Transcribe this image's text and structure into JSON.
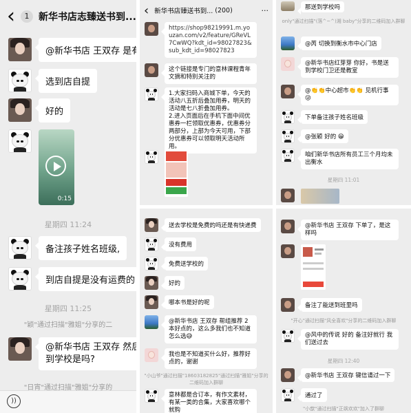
{
  "left": {
    "header": {
      "back": "‹",
      "badge": "1",
      "title": "新华书店志臻送书到..."
    },
    "messages": [
      {
        "text": "@新华书店 王双存 是有"
      },
      {
        "text": "选到店自提"
      },
      {
        "text": "好的"
      },
      {
        "text": "备注孩子姓名班级,"
      },
      {
        "text": "到店自提是没有运费的"
      },
      {
        "text": "@新华书店 王双存 然后"
      },
      {
        "text": "到学校是吗?"
      }
    ],
    "video_duration": "0:15",
    "times": [
      "星期四 11:24",
      "星期四 11:25"
    ],
    "sys": [
      "\"颖\"通过扫描\"雅姐\"分享的二",
      "\"日宵\"通过扫描\"雅姐\"分享的"
    ]
  },
  "mid_top": {
    "header": {
      "title": "新华书店臻送书到...",
      "count": "(200)",
      "more": "···"
    },
    "link": "https://shop98219991.m.youzan.com/v2/feature/GReVL7CwWQ?kdt_id=98027823&sub_kdt_id=98027823",
    "msg2": "这个链接是专门的意林课程青年文摘和特别关注的",
    "msg3": "1.大家扫码入商城下单，今天的活动八五折后叠加用券，明天的活动是七八折叠加用券。\n2.进入页面后在手机下面中间优惠券一栏领取优惠券，优惠券分两部分，上部为今天可用，下部分优惠券可以领取明天活动所用。"
  },
  "mid_bottom": {
    "messages": [
      "送去学校是免费的吗还是有快递费",
      "没有费用",
      "免费送学校的",
      "好的",
      "哪本书是好的呢",
      "@新华书店 王双存 帮组推荐 2 本好点的，这么多我们也不知道怎么选😅",
      "我也是不知道买什么好，推荐好点的，谢谢",
      "意林都是合订本，有作文素材，有某一类的合集，大家喜欢哪个就购"
    ],
    "sys": "\"小山爷\"通过扫描\"18603182825\"通过扫描\"雅姐\"分享的二维码加入群聊"
  },
  "right_top": {
    "messages": [
      "那送到学校吗",
      "@芮 切换到衡水市中心门店",
      "@新华书店红芽芽 你好，书是送到学校门卫还是教室",
      "@👏👏中心超市👏👏 见机行事 😜",
      "下单备注孩子姓名班级",
      "@张颖 好的 😁",
      "咱们新华书店所有员工三个月均未出衡水"
    ],
    "sys": "only\"通过扫描\"(落^~^)湘 baby\"分享的二维码加入群聊",
    "time": "星期四 11:01"
  },
  "right_bottom": {
    "messages": [
      "@新华书店 王双存 下单了，是这样吗",
      "备注了能送到班里吗",
      "@风中的传说 好的 备注好就行 我们送过去",
      "@新华书店 王双存 键信请过一下",
      "通过了"
    ],
    "sys": [
      "\"开心\"通过扫描\"风全喜欢\"分享的二维码加入群聊",
      "\"小歆\"通过扫描\"正飒欢欢\"加入了群聊"
    ],
    "time": "星期四 12:40"
  },
  "colors": {
    "bg": "#ededed",
    "bubble": "#ffffff",
    "accent": "#3cb34a",
    "sys_link": "#5a6a8a"
  }
}
